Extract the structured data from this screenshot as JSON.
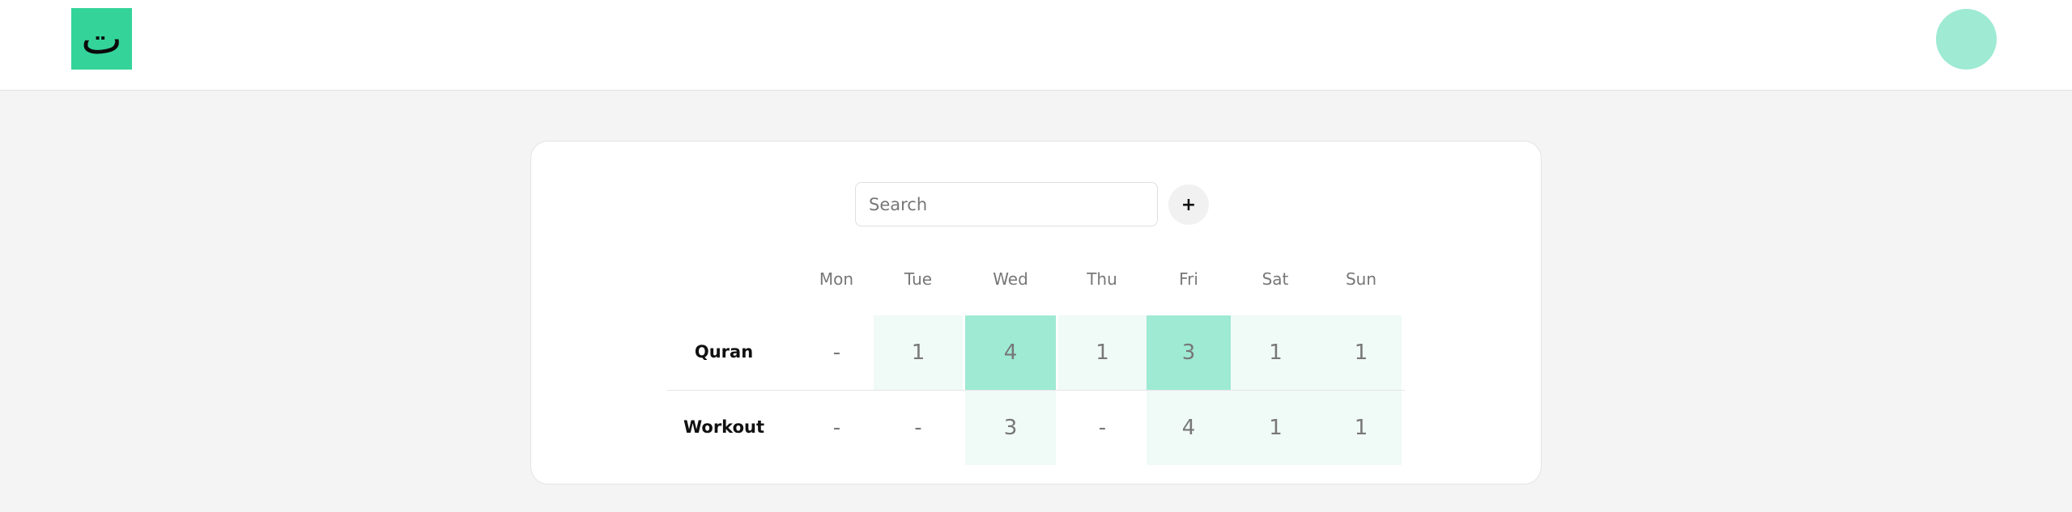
{
  "header": {
    "logo_text": "ت",
    "logo_color": "#34d399",
    "avatar_color": "#9eead3"
  },
  "toolbar": {
    "search_placeholder": "Search",
    "add_label": "+"
  },
  "tracker": {
    "days": [
      "Mon",
      "Tue",
      "Wed",
      "Thu",
      "Fri",
      "Sat",
      "Sun"
    ],
    "level_colors": {
      "none": "transparent",
      "light": "#f0faf6",
      "strong": "#9eead3"
    },
    "rows": [
      {
        "name": "Quran",
        "cells": [
          {
            "value": "-",
            "level": "none"
          },
          {
            "value": "1",
            "level": "light"
          },
          {
            "value": "4",
            "level": "strong"
          },
          {
            "value": "1",
            "level": "light"
          },
          {
            "value": "3",
            "level": "strong"
          },
          {
            "value": "1",
            "level": "light"
          },
          {
            "value": "1",
            "level": "light"
          }
        ]
      },
      {
        "name": "Workout",
        "cells": [
          {
            "value": "-",
            "level": "none"
          },
          {
            "value": "-",
            "level": "none"
          },
          {
            "value": "3",
            "level": "light"
          },
          {
            "value": "-",
            "level": "none"
          },
          {
            "value": "4",
            "level": "light"
          },
          {
            "value": "1",
            "level": "light"
          },
          {
            "value": "1",
            "level": "light"
          }
        ]
      }
    ]
  }
}
